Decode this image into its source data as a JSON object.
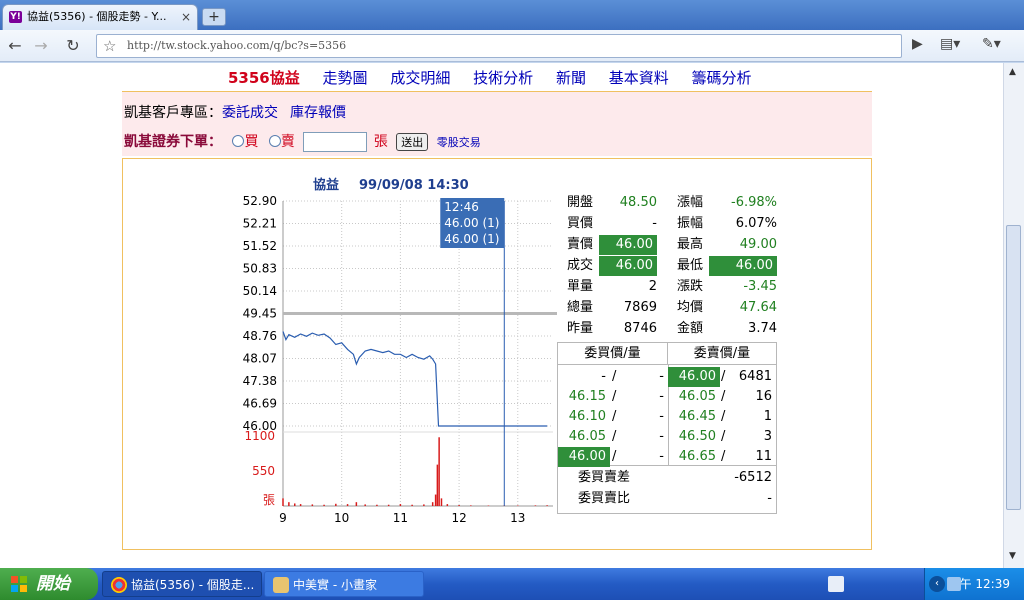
{
  "browser": {
    "tab_title": "協益(5356) - 個股走勢 - Y...",
    "url": "http://tw.stock.yahoo.com/q/bc?s=5356",
    "tab_close": "×",
    "new_tab": "+"
  },
  "nav": {
    "code": "5356",
    "name": "協益",
    "links": [
      "走勢圖",
      "成交明細",
      "技術分析",
      "新聞",
      "基本資料",
      "籌碼分析"
    ]
  },
  "broker": {
    "zone_label": "凱基客戶專區：",
    "link1": "委託成交",
    "link2": "庫存報價",
    "order_label": "凱基證券下單：",
    "buy": "買",
    "sell": "賣",
    "unit": "張",
    "submit": "送出",
    "odd_lot": "零股交易"
  },
  "chart_header": {
    "name": "協益",
    "datetime": "99/09/08 14:30"
  },
  "tooltip": {
    "time": "12:46",
    "line1": "46.00 (1)",
    "line2": "46.00 (1)"
  },
  "chart_data": {
    "type": "line",
    "title": "協益  99/09/08 14:30",
    "x_ticks": [
      "9",
      "10",
      "11",
      "12",
      "13"
    ],
    "y_ticks": [
      "52.90",
      "52.21",
      "51.52",
      "50.83",
      "50.14",
      "49.45",
      "48.76",
      "48.07",
      "47.38",
      "46.69",
      "46.00"
    ],
    "ylim": [
      46.0,
      52.9
    ],
    "reference_price": 49.45,
    "volume_ticks": [
      "1100",
      "550",
      "張"
    ],
    "volume_ylim": [
      0,
      1100
    ],
    "series": [
      {
        "values": [
          [
            9.0,
            48.9
          ],
          [
            9.05,
            48.65
          ],
          [
            9.1,
            48.8
          ],
          [
            9.2,
            48.72
          ],
          [
            9.3,
            48.82
          ],
          [
            9.4,
            48.75
          ],
          [
            9.5,
            48.85
          ],
          [
            9.6,
            48.78
          ],
          [
            9.7,
            48.82
          ],
          [
            9.8,
            48.7
          ],
          [
            9.9,
            48.5
          ],
          [
            10.0,
            48.55
          ],
          [
            10.1,
            48.35
          ],
          [
            10.2,
            48.2
          ],
          [
            10.25,
            47.9
          ],
          [
            10.3,
            48.1
          ],
          [
            10.4,
            48.3
          ],
          [
            10.5,
            48.35
          ],
          [
            10.6,
            48.3
          ],
          [
            10.7,
            48.25
          ],
          [
            10.8,
            48.3
          ],
          [
            10.9,
            48.2
          ],
          [
            11.0,
            48.2
          ],
          [
            11.1,
            48.1
          ],
          [
            11.2,
            48.2
          ],
          [
            11.3,
            48.1
          ],
          [
            11.4,
            48.05
          ],
          [
            11.5,
            48.15
          ],
          [
            11.55,
            48.05
          ],
          [
            11.6,
            47.9
          ],
          [
            11.65,
            46.0
          ],
          [
            12.0,
            46.0
          ],
          [
            13.0,
            46.0
          ],
          [
            13.5,
            46.0
          ]
        ]
      }
    ],
    "volume": [
      [
        9.0,
        120
      ],
      [
        9.1,
        60
      ],
      [
        9.2,
        40
      ],
      [
        9.3,
        30
      ],
      [
        9.5,
        25
      ],
      [
        9.7,
        20
      ],
      [
        9.9,
        35
      ],
      [
        10.1,
        30
      ],
      [
        10.25,
        60
      ],
      [
        10.4,
        25
      ],
      [
        10.6,
        20
      ],
      [
        10.8,
        20
      ],
      [
        11.0,
        30
      ],
      [
        11.2,
        20
      ],
      [
        11.4,
        25
      ],
      [
        11.55,
        60
      ],
      [
        11.6,
        180
      ],
      [
        11.63,
        650
      ],
      [
        11.66,
        1080
      ],
      [
        11.7,
        120
      ],
      [
        11.8,
        30
      ],
      [
        12.0,
        15
      ],
      [
        12.2,
        10
      ],
      [
        12.5,
        8
      ],
      [
        12.77,
        10
      ],
      [
        13.0,
        8
      ],
      [
        13.3,
        10
      ],
      [
        13.5,
        12
      ]
    ],
    "cursor_x": 12.77
  },
  "quote": {
    "open_label": "開盤",
    "open": "48.50",
    "change_pct_label": "漲幅",
    "change_pct": "-6.98%",
    "bid_label": "買價",
    "bid": "-",
    "amplitude_label": "振幅",
    "amplitude": "6.07%",
    "ask_label": "賣價",
    "ask": "46.00",
    "high_label": "最高",
    "high": "49.00",
    "last_label": "成交",
    "last": "46.00",
    "low_label": "最低",
    "low": "46.00",
    "single_label": "單量",
    "single": "2",
    "change_label": "漲跌",
    "change": "-3.45",
    "total_label": "總量",
    "total": "7869",
    "avg_label": "均價",
    "avg": "47.64",
    "prev_label": "昨量",
    "prev": "8746",
    "amount_label": "金額",
    "amount": "3.74"
  },
  "orders": {
    "buy_header": "委買價/量",
    "sell_header": "委賣價/量",
    "rows": [
      {
        "buy_price": "-",
        "buy_qty": "-",
        "sell_price": "46.00",
        "sell_qty": "6481"
      },
      {
        "buy_price": "46.15",
        "buy_qty": "-",
        "sell_price": "46.05",
        "sell_qty": "16"
      },
      {
        "buy_price": "46.10",
        "buy_qty": "-",
        "sell_price": "46.45",
        "sell_qty": "1"
      },
      {
        "buy_price": "46.05",
        "buy_qty": "-",
        "sell_price": "46.50",
        "sell_qty": "3"
      },
      {
        "buy_price": "46.00",
        "buy_qty": "-",
        "sell_price": "46.65",
        "sell_qty": "11"
      }
    ],
    "diff_label": "委買賣差",
    "diff": "-6512",
    "ratio_label": "委買賣比",
    "ratio": "-"
  },
  "taskbar": {
    "start": "開始",
    "task1": "協益(5356) - 個股走...",
    "task2": "中美實 - 小畫家",
    "clock": "上午 12:39"
  },
  "colors": {
    "price_line": "#2a5db0",
    "volume": "#d81b1b",
    "highlight": "#2f8f3a",
    "up_down_text": "#208020",
    "tooltip_bg": "#3a6db5"
  }
}
